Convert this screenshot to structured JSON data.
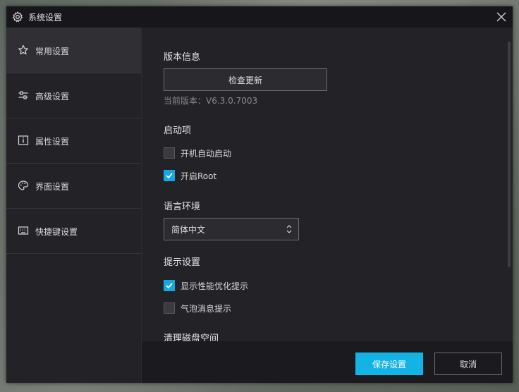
{
  "window": {
    "title": "系统设置",
    "title_icon": "gear-icon",
    "close_icon": "close-icon"
  },
  "sidebar": {
    "items": [
      {
        "label": "常用设置",
        "icon": "star-icon",
        "active": true
      },
      {
        "label": "高级设置",
        "icon": "sliders-icon",
        "active": false
      },
      {
        "label": "属性设置",
        "icon": "info-icon",
        "active": false
      },
      {
        "label": "界面设置",
        "icon": "palette-icon",
        "active": false
      },
      {
        "label": "快捷键设置",
        "icon": "keyboard-icon",
        "active": false
      }
    ]
  },
  "main": {
    "version_section": {
      "title": "版本信息",
      "check_update_label": "检查更新",
      "current_version": "当前版本：V6.3.0.7003"
    },
    "startup_section": {
      "title": "启动项",
      "options": [
        {
          "label": "开机自动启动",
          "checked": false
        },
        {
          "label": "开启Root",
          "checked": true
        }
      ]
    },
    "language_section": {
      "title": "语言环境",
      "selected": "简体中文"
    },
    "tips_section": {
      "title": "提示设置",
      "options": [
        {
          "label": "显示性能优化提示",
          "checked": true
        },
        {
          "label": "气泡消息提示",
          "checked": false
        }
      ]
    },
    "disk_section": {
      "title": "清理磁盘空间"
    }
  },
  "footer": {
    "save_label": "保存设置",
    "cancel_label": "取消"
  },
  "colors": {
    "accent": "#14b3e6",
    "dialog_bg": "#232327",
    "titlebar_bg": "#17171b"
  }
}
